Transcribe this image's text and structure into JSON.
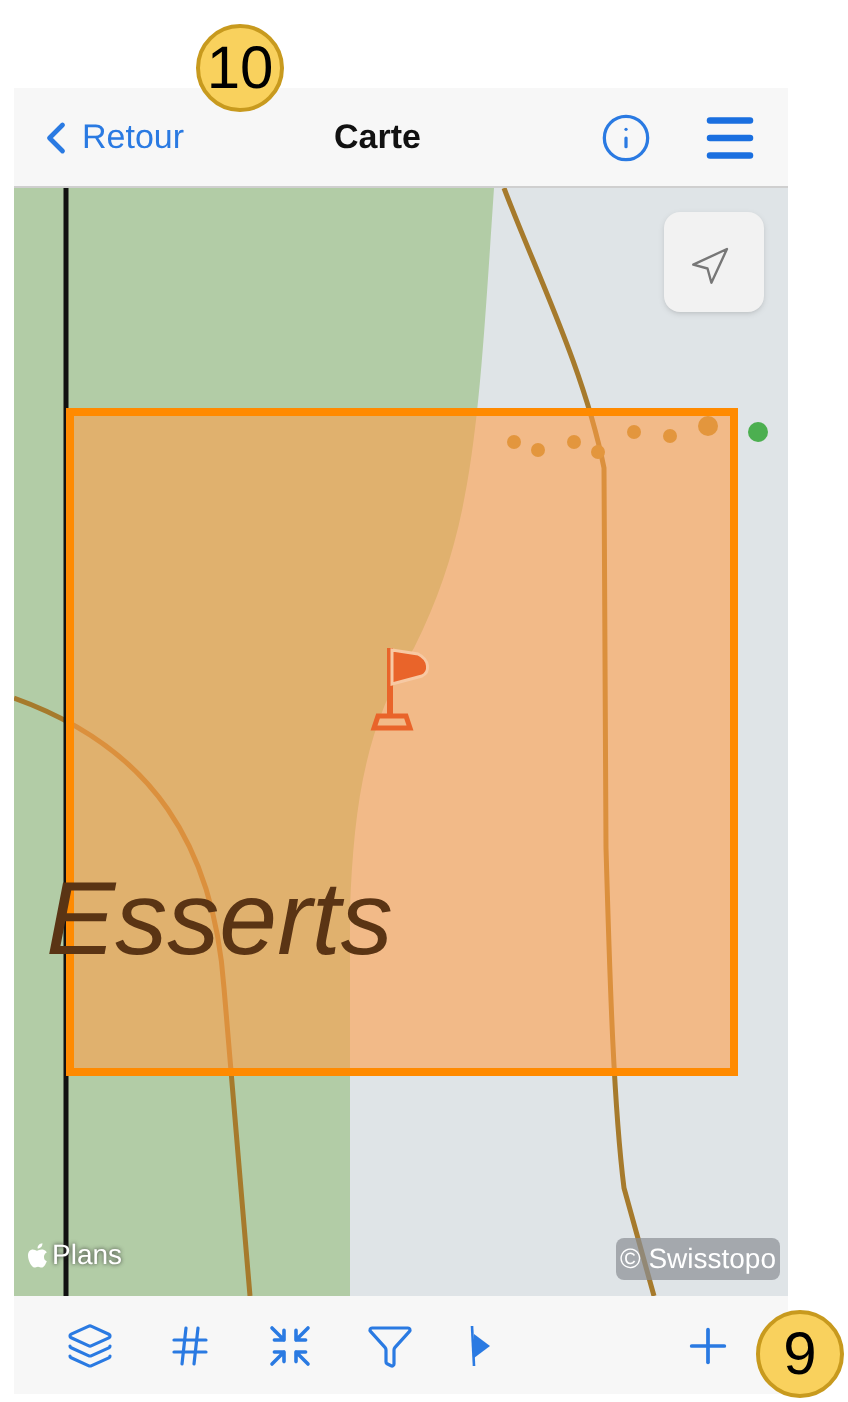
{
  "header": {
    "back_label": "Retour",
    "title": "Carte"
  },
  "map": {
    "place_label": "Esserts",
    "attribution_left": "Plans",
    "attribution_right": "© Swisstopo"
  },
  "callouts": [
    {
      "label": "10"
    },
    {
      "label": "9"
    }
  ]
}
